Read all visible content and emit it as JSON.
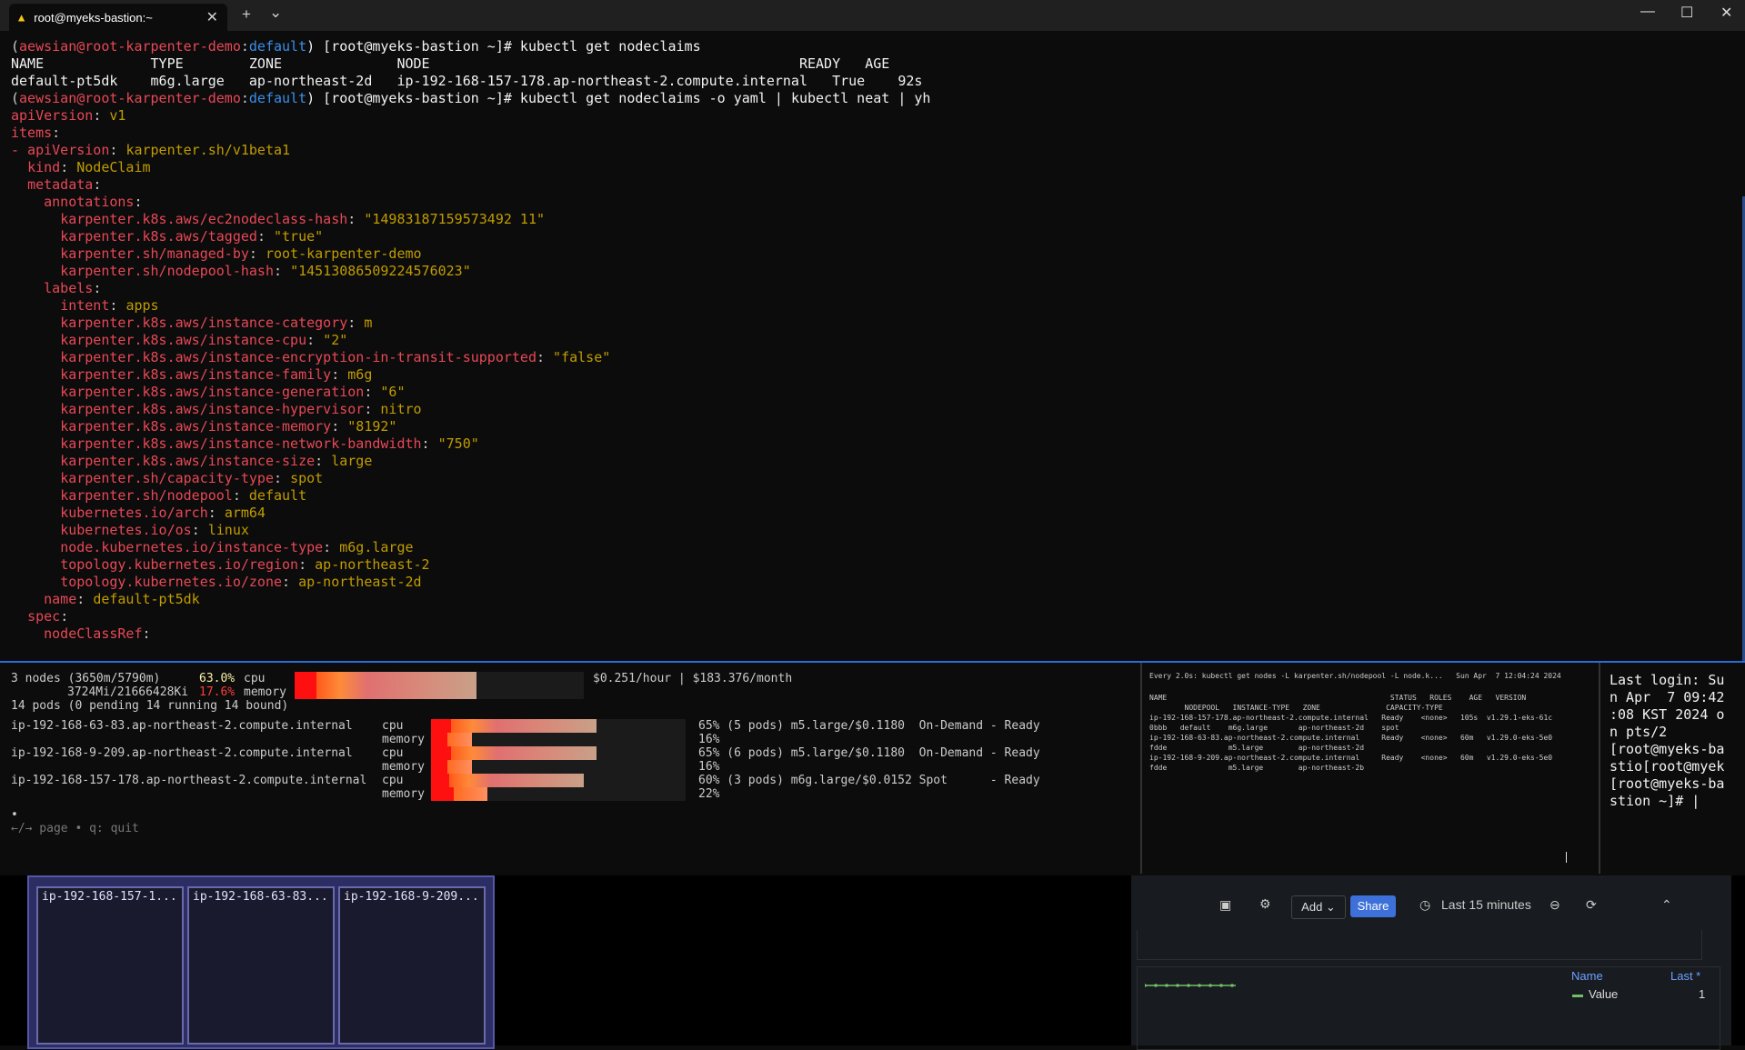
{
  "tab": {
    "title": "root@myeks-bastion:~",
    "icon": "linux-penguin-icon"
  },
  "titlebar": {
    "new_tab": "+",
    "dropdown": "⌄",
    "minimize": "—",
    "maximize": "☐",
    "close": "✕"
  },
  "main_terminal": {
    "prompt1": {
      "paren_open": "(",
      "user": "aewsian@root-karpenter-demo",
      "colon": ":",
      "ns": "default",
      "rest": ") [root@myeks-bastion ~]# kubectl get nodeclaims"
    },
    "table_header": "NAME             TYPE        ZONE              NODE                                             READY   AGE",
    "table_row": "default-pt5dk    m6g.large   ap-northeast-2d   ip-192-168-157-178.ap-northeast-2.compute.internal   True    92s",
    "prompt2": {
      "paren_open": "(",
      "user": "aewsian@root-karpenter-demo",
      "colon": ":",
      "ns": "default",
      "rest": ") [root@myeks-bastion ~]# kubectl get nodeclaims -o yaml | kubectl neat | yh"
    },
    "yaml": [
      {
        "indent": "",
        "key": "apiVersion",
        "sep": ": ",
        "val": "v1"
      },
      {
        "indent": "",
        "key": "items",
        "sep": ":",
        "val": ""
      },
      {
        "indent": "",
        "key": "- apiVersion",
        "sep": ": ",
        "val": "karpenter.sh/v1beta1"
      },
      {
        "indent": "  ",
        "key": "kind",
        "sep": ": ",
        "val": "NodeClaim"
      },
      {
        "indent": "  ",
        "key": "metadata",
        "sep": ":",
        "val": ""
      },
      {
        "indent": "    ",
        "key": "annotations",
        "sep": ":",
        "val": ""
      },
      {
        "indent": "      ",
        "key": "karpenter.k8s.aws/ec2nodeclass-hash",
        "sep": ": ",
        "val": "\"14983187159573492 11\""
      },
      {
        "indent": "      ",
        "key": "karpenter.k8s.aws/tagged",
        "sep": ": ",
        "val": "\"true\""
      },
      {
        "indent": "      ",
        "key": "karpenter.sh/managed-by",
        "sep": ": ",
        "val": "root-karpenter-demo"
      },
      {
        "indent": "      ",
        "key": "karpenter.sh/nodepool-hash",
        "sep": ": ",
        "val": "\"14513086509224576023\""
      },
      {
        "indent": "    ",
        "key": "labels",
        "sep": ":",
        "val": ""
      },
      {
        "indent": "      ",
        "key": "intent",
        "sep": ": ",
        "val": "apps"
      },
      {
        "indent": "      ",
        "key": "karpenter.k8s.aws/instance-category",
        "sep": ": ",
        "val": "m"
      },
      {
        "indent": "      ",
        "key": "karpenter.k8s.aws/instance-cpu",
        "sep": ": ",
        "val": "\"2\""
      },
      {
        "indent": "      ",
        "key": "karpenter.k8s.aws/instance-encryption-in-transit-supported",
        "sep": ": ",
        "val": "\"false\""
      },
      {
        "indent": "      ",
        "key": "karpenter.k8s.aws/instance-family",
        "sep": ": ",
        "val": "m6g"
      },
      {
        "indent": "      ",
        "key": "karpenter.k8s.aws/instance-generation",
        "sep": ": ",
        "val": "\"6\""
      },
      {
        "indent": "      ",
        "key": "karpenter.k8s.aws/instance-hypervisor",
        "sep": ": ",
        "val": "nitro"
      },
      {
        "indent": "      ",
        "key": "karpenter.k8s.aws/instance-memory",
        "sep": ": ",
        "val": "\"8192\""
      },
      {
        "indent": "      ",
        "key": "karpenter.k8s.aws/instance-network-bandwidth",
        "sep": ": ",
        "val": "\"750\""
      },
      {
        "indent": "      ",
        "key": "karpenter.k8s.aws/instance-size",
        "sep": ": ",
        "val": "large"
      },
      {
        "indent": "      ",
        "key": "karpenter.sh/capacity-type",
        "sep": ": ",
        "val": "spot"
      },
      {
        "indent": "      ",
        "key": "karpenter.sh/nodepool",
        "sep": ": ",
        "val": "default"
      },
      {
        "indent": "      ",
        "key": "kubernetes.io/arch",
        "sep": ": ",
        "val": "arm64"
      },
      {
        "indent": "      ",
        "key": "kubernetes.io/os",
        "sep": ": ",
        "val": "linux"
      },
      {
        "indent": "      ",
        "key": "node.kubernetes.io/instance-type",
        "sep": ": ",
        "val": "m6g.large"
      },
      {
        "indent": "      ",
        "key": "topology.kubernetes.io/region",
        "sep": ": ",
        "val": "ap-northeast-2"
      },
      {
        "indent": "      ",
        "key": "topology.kubernetes.io/zone",
        "sep": ": ",
        "val": "ap-northeast-2d"
      },
      {
        "indent": "    ",
        "key": "name",
        "sep": ": ",
        "val": "default-pt5dk"
      },
      {
        "indent": "  ",
        "key": "spec",
        "sep": ":",
        "val": ""
      },
      {
        "indent": "    ",
        "key": "nodeClassRef",
        "sep": ":",
        "val": ""
      }
    ]
  },
  "viewer": {
    "summary_nodes": "3 nodes (3650m/5790m)",
    "cpu_pct": "63.0%",
    "cpu_label": "cpu",
    "summary_mem": "3724Mi/21666428Ki",
    "mem_pct": "17.6%",
    "mem_label": "memory",
    "cost": "$0.251/hour | $183.376/month",
    "pods": "14 pods (0 pending 14 running 14 bound)",
    "cpu_fraction": 0.63,
    "nodes": [
      {
        "name": "ip-192-168-63-83.ap-northeast-2.compute.internal",
        "cpu_label": "cpu",
        "mem_label": "memory",
        "cpu_text": "65% (5 pods) m5.large/$0.1180  On-Demand - Ready",
        "mem_text": "16%",
        "cpu_frac": 0.65,
        "mem_frac": 0.16
      },
      {
        "name": "ip-192-168-9-209.ap-northeast-2.compute.internal",
        "cpu_label": "cpu",
        "mem_label": "memory",
        "cpu_text": "65% (6 pods) m5.large/$0.1180  On-Demand - Ready",
        "mem_text": "16%",
        "cpu_frac": 0.65,
        "mem_frac": 0.16
      },
      {
        "name": "ip-192-168-157-178.ap-northeast-2.compute.internal",
        "cpu_label": "cpu",
        "mem_label": "memory",
        "cpu_text": "60% (3 pods) m6g.large/$0.0152 Spot      - Ready",
        "mem_text": "22%",
        "cpu_frac": 0.6,
        "mem_frac": 0.22
      }
    ],
    "dot": "•",
    "help": "←/→ page • q: quit"
  },
  "watch": {
    "header": "Every 2.0s: kubectl get nodes -L karpenter.sh/nodepool -L node.k...   Sun Apr  7 12:04:24 2024",
    "lines": [
      "NAME                                                   STATUS   ROLES    AGE   VERSION",
      "        NODEPOOL   INSTANCE-TYPE   ZONE               CAPACITY-TYPE",
      "ip-192-168-157-178.ap-northeast-2.compute.internal   Ready    <none>   105s  v1.29.1-eks-61c",
      "0bbb   default    m6g.large       ap-northeast-2d    spot",
      "ip-192-168-63-83.ap-northeast-2.compute.internal     Ready    <none>   60m   v1.29.0-eks-5e0",
      "fdde              m5.large        ap-northeast-2d",
      "ip-192-168-9-209.ap-northeast-2.compute.internal     Ready    <none>   60m   v1.29.0-eks-5e0",
      "fdde              m5.large        ap-northeast-2b"
    ]
  },
  "login": {
    "lines": [
      "Last login: Su",
      "n Apr  7 09:42",
      ":08 KST 2024 o",
      "n pts/2",
      "[root@myeks-ba",
      "stio[root@myek",
      "[root@myeks-ba",
      "stion ~]# |"
    ]
  },
  "viz": {
    "nodes": [
      "ip-192-168-157-1...",
      "ip-192-168-63-83...",
      "ip-192-168-9-209..."
    ]
  },
  "grafana": {
    "add": "Add ⌄",
    "share": "Share",
    "range": "Last 15 minutes",
    "legend_name": "Name",
    "legend_last": "Last *",
    "legend_series": "Value",
    "legend_value": "1",
    "series_color": "#73bf69"
  }
}
